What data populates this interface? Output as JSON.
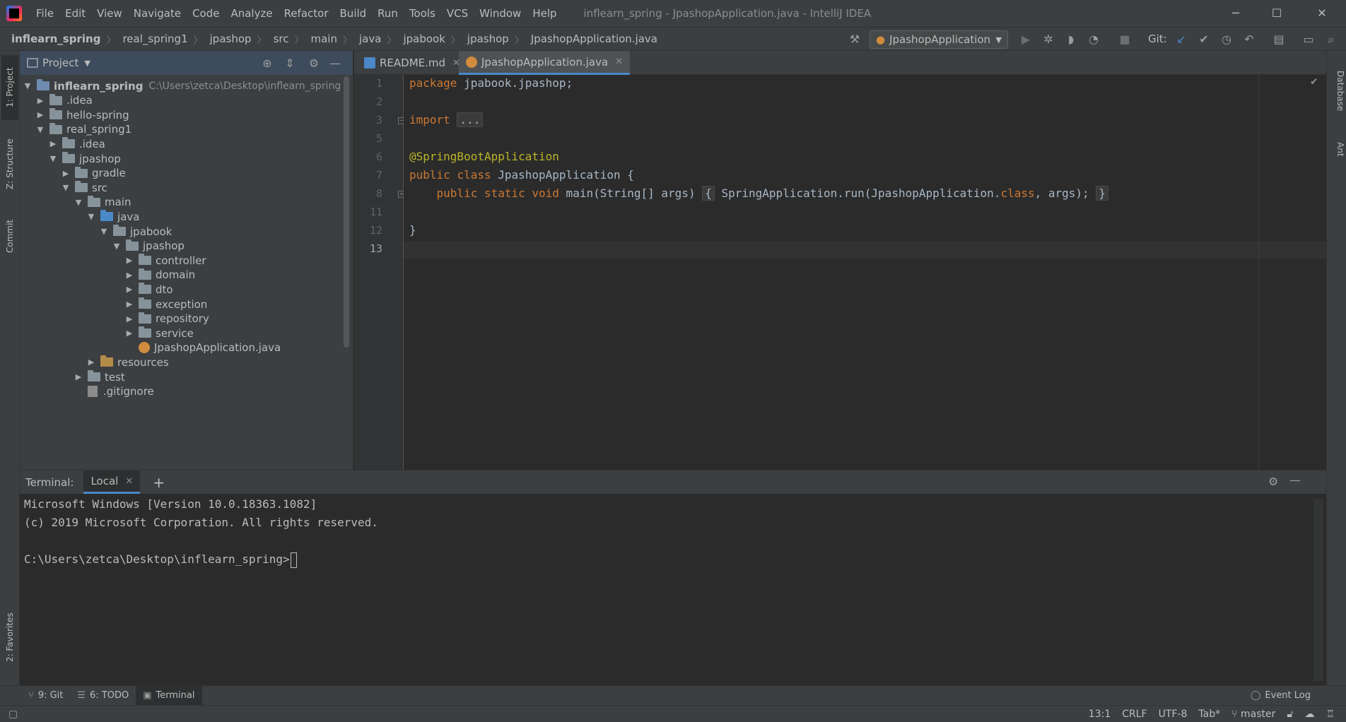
{
  "menu": {
    "items": [
      "File",
      "Edit",
      "View",
      "Navigate",
      "Code",
      "Analyze",
      "Refactor",
      "Build",
      "Run",
      "Tools",
      "VCS",
      "Window",
      "Help"
    ],
    "window_title": "inflearn_spring - JpashopApplication.java - IntelliJ IDEA"
  },
  "breadcrumbs": [
    "inflearn_spring",
    "real_spring1",
    "jpashop",
    "src",
    "main",
    "java",
    "jpabook",
    "jpashop",
    "JpashopApplication.java"
  ],
  "toolbar": {
    "run_config": "JpashopApplication",
    "git_label": "Git:"
  },
  "left_stripe": {
    "project": "1: Project",
    "structure": "Z: Structure",
    "commit": "Commit",
    "favorites": "2: Favorites"
  },
  "right_stripe": {
    "database": "Database",
    "ant": "Ant"
  },
  "project_panel": {
    "title": "Project",
    "tree": [
      {
        "label": "inflearn_spring",
        "hint": "C:\\Users\\zetca\\Desktop\\inflearn_spring",
        "arrow": "▼",
        "type": "module",
        "depth": 0,
        "bold": true
      },
      {
        "label": ".idea",
        "arrow": "▶",
        "type": "folder",
        "depth": 1
      },
      {
        "label": "hello-spring",
        "arrow": "▶",
        "type": "folder",
        "depth": 1
      },
      {
        "label": "real_spring1",
        "arrow": "▼",
        "type": "folder",
        "depth": 1
      },
      {
        "label": ".idea",
        "arrow": "▶",
        "type": "folder",
        "depth": 2
      },
      {
        "label": "jpashop",
        "arrow": "▼",
        "type": "folder",
        "depth": 2
      },
      {
        "label": "gradle",
        "arrow": "▶",
        "type": "folder",
        "depth": 3
      },
      {
        "label": "src",
        "arrow": "▼",
        "type": "folder",
        "depth": 3
      },
      {
        "label": "main",
        "arrow": "▼",
        "type": "folder",
        "depth": 4
      },
      {
        "label": "java",
        "arrow": "▼",
        "type": "src",
        "depth": 5
      },
      {
        "label": "jpabook",
        "arrow": "▼",
        "type": "folder",
        "depth": 6
      },
      {
        "label": "jpashop",
        "arrow": "▼",
        "type": "folder",
        "depth": 7
      },
      {
        "label": "controller",
        "arrow": "▶",
        "type": "folder",
        "depth": 8
      },
      {
        "label": "domain",
        "arrow": "▶",
        "type": "folder",
        "depth": 8
      },
      {
        "label": "dto",
        "arrow": "▶",
        "type": "folder",
        "depth": 8
      },
      {
        "label": "exception",
        "arrow": "▶",
        "type": "folder",
        "depth": 8
      },
      {
        "label": "repository",
        "arrow": "▶",
        "type": "folder",
        "depth": 8
      },
      {
        "label": "service",
        "arrow": "▶",
        "type": "folder",
        "depth": 8
      },
      {
        "label": "JpashopApplication.java",
        "arrow": "",
        "type": "java",
        "depth": 8
      },
      {
        "label": "resources",
        "arrow": "▶",
        "type": "res",
        "depth": 5
      },
      {
        "label": "test",
        "arrow": "▶",
        "type": "folder",
        "depth": 4
      },
      {
        "label": ".gitignore",
        "arrow": "",
        "type": "git",
        "depth": 4
      }
    ]
  },
  "editor": {
    "tabs": [
      {
        "label": "README.md",
        "active": false
      },
      {
        "label": "JpashopApplication.java",
        "active": true
      }
    ],
    "line_numbers": [
      "1",
      "2",
      "3",
      "5",
      "6",
      "7",
      "8",
      "11",
      "12",
      "13"
    ],
    "code": {
      "l1_kw": "package",
      "l1_rest": " jpabook.jpashop;",
      "l3_kw": "import",
      "l3_fold": "...",
      "l6_ann": "@SpringBootApplication",
      "l7_kw": "public class",
      "l7_rest": " JpashopApplication {",
      "l8_kw": "public static void",
      "l8_rest": " main(String[] args) ",
      "l8_fold_open": "{",
      "l8_body": " SpringApplication.run(JpashopApplication.",
      "l8_class": "class",
      "l8_tail": ", args);",
      "l8_fold_close": "}",
      "l12": "}"
    }
  },
  "terminal": {
    "label": "Terminal:",
    "tab": "Local",
    "lines": [
      "Microsoft Windows [Version 10.0.18363.1082]",
      "(c) 2019 Microsoft Corporation. All rights reserved.",
      "",
      "C:\\Users\\zetca\\Desktop\\inflearn_spring>"
    ]
  },
  "tool_windows": {
    "git": "9: Git",
    "todo": "6: TODO",
    "terminal": "Terminal",
    "event_log": "Event Log"
  },
  "status": {
    "position": "13:1",
    "line_sep": "CRLF",
    "encoding": "UTF-8",
    "indent": "Tab*",
    "branch": "master"
  }
}
